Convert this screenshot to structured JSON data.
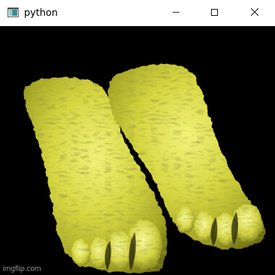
{
  "window": {
    "title": "python",
    "app_icon": "python-window-icon",
    "buttons": {
      "minimize": "minimize-icon",
      "maximize": "maximize-icon",
      "close": "close-icon"
    }
  },
  "viewport": {
    "background": "#000000",
    "render_color": "#d8d848",
    "subject": "volume-rendered-feet"
  },
  "watermark": {
    "text": "imgflip.com"
  }
}
